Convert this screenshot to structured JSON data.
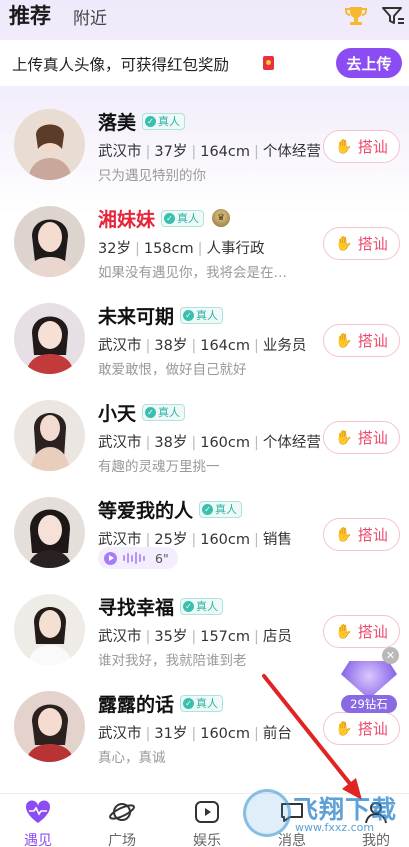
{
  "header": {
    "tab_recommend": "推荐",
    "tab_nearby": "附近",
    "trophy_icon": "trophy-icon",
    "filter_icon": "filter-icon"
  },
  "banner": {
    "text": "上传真人头像，可获得红包奖励",
    "button": "去上传"
  },
  "verified_label": "真人",
  "greet_label": "搭讪",
  "users": [
    {
      "name": "落美",
      "info": [
        "武汉市",
        "37岁",
        "164cm",
        "个体经营"
      ],
      "desc": "只为遇见特别的你"
    },
    {
      "name": "湘妹妹",
      "info": [
        "32岁",
        "158cm",
        "人事行政"
      ],
      "desc": "如果没有遇见你，我将会是在…",
      "vip": true
    },
    {
      "name": "未来可期",
      "info": [
        "武汉市",
        "38岁",
        "164cm",
        "业务员"
      ],
      "desc": "敢爱敢恨，做好自己就好"
    },
    {
      "name": "小天",
      "info": [
        "武汉市",
        "38岁",
        "160cm",
        "个体经营"
      ],
      "desc": "有趣的灵魂万里挑一"
    },
    {
      "name": "等爱我的人",
      "info": [
        "武汉市",
        "25岁",
        "160cm",
        "销售"
      ],
      "voice_duration": "6\""
    },
    {
      "name": "寻找幸福",
      "info": [
        "武汉市",
        "35岁",
        "157cm",
        "店员"
      ],
      "desc": "谁对我好，我就陪谁到老"
    },
    {
      "name": "露露的话",
      "info": [
        "武汉市",
        "31岁",
        "160cm",
        "前台"
      ],
      "desc": "真心，真诚"
    }
  ],
  "gift": {
    "label": "29钻石"
  },
  "nav": [
    {
      "label": "遇见",
      "icon": "heart-pulse-icon",
      "active": true
    },
    {
      "label": "广场",
      "icon": "planet-icon"
    },
    {
      "label": "娱乐",
      "icon": "play-icon"
    },
    {
      "label": "消息",
      "icon": "message-icon"
    },
    {
      "label": "我的",
      "icon": "profile-icon"
    }
  ],
  "watermark": {
    "text": "飞翔下载",
    "url": "www.fxxz.com"
  },
  "colors": {
    "accent": "#8b4df3",
    "greet": "#ee4a6b",
    "verified": "#2bb3a2",
    "vip_name": "#e6243a"
  }
}
